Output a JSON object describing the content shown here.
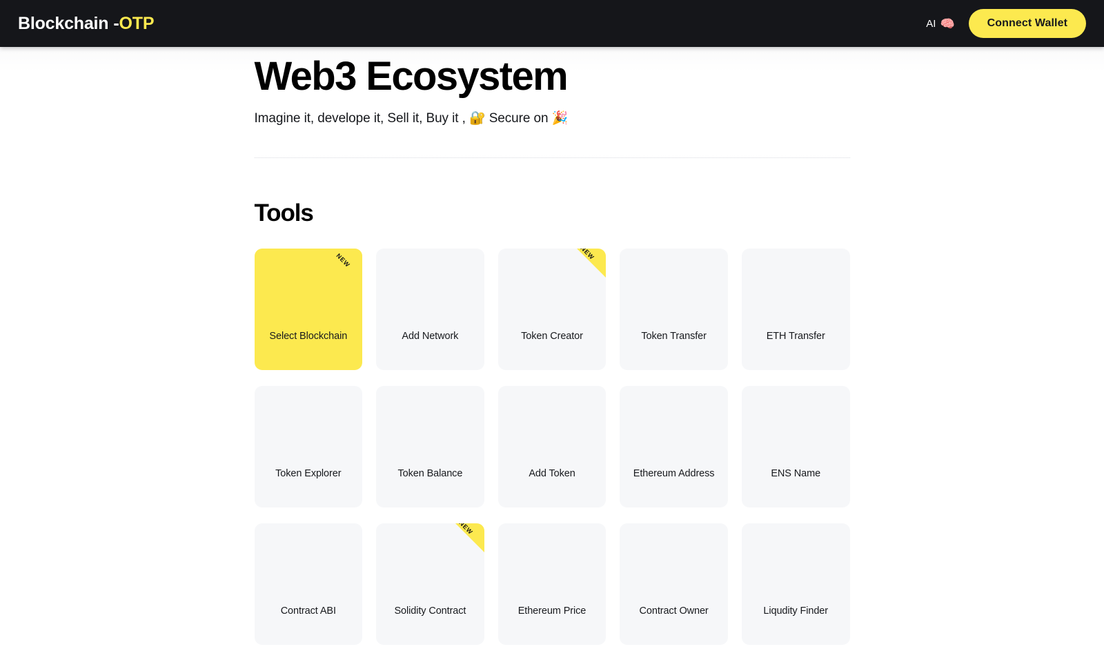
{
  "header": {
    "brand_main": "Blockchain",
    "brand_separator": "-",
    "brand_accent": "OTP",
    "ai_label": "AI",
    "ai_emoji": "🧠",
    "connect_wallet_label": "Connect Wallet",
    "background_color": "#15161a",
    "accent_color": "#FCE94F"
  },
  "hero": {
    "title": "Web3 Ecosystem",
    "subtitle": "Imagine it, develope it, Sell it, Buy it , 🔐 Secure on 🎉"
  },
  "tools_section": {
    "title": "Tools",
    "new_badge_label": "NEW",
    "card_background": "#f6f7f9",
    "active_card_background": "#FCE94F",
    "cards": [
      {
        "label": "Select Blockchain",
        "active": true,
        "new": true,
        "ribbon_overflow": false
      },
      {
        "label": "Add Network",
        "active": false,
        "new": false,
        "ribbon_overflow": false
      },
      {
        "label": "Token Creator",
        "active": false,
        "new": true,
        "ribbon_overflow": true
      },
      {
        "label": "Token Transfer",
        "active": false,
        "new": false,
        "ribbon_overflow": false
      },
      {
        "label": "ETH Transfer",
        "active": false,
        "new": false,
        "ribbon_overflow": false
      },
      {
        "label": "Token Explorer",
        "active": false,
        "new": false,
        "ribbon_overflow": false
      },
      {
        "label": "Token Balance",
        "active": false,
        "new": false,
        "ribbon_overflow": false
      },
      {
        "label": "Add Token",
        "active": false,
        "new": false,
        "ribbon_overflow": false
      },
      {
        "label": "Ethereum Address",
        "active": false,
        "new": false,
        "ribbon_overflow": false
      },
      {
        "label": "ENS Name",
        "active": false,
        "new": false,
        "ribbon_overflow": false
      },
      {
        "label": "Contract ABI",
        "active": false,
        "new": false,
        "ribbon_overflow": false
      },
      {
        "label": "Solidity Contract",
        "active": false,
        "new": true,
        "ribbon_overflow": true
      },
      {
        "label": "Ethereum Price",
        "active": false,
        "new": false,
        "ribbon_overflow": false
      },
      {
        "label": "Contract Owner",
        "active": false,
        "new": false,
        "ribbon_overflow": false
      },
      {
        "label": "Liqudity Finder",
        "active": false,
        "new": false,
        "ribbon_overflow": false
      }
    ]
  }
}
